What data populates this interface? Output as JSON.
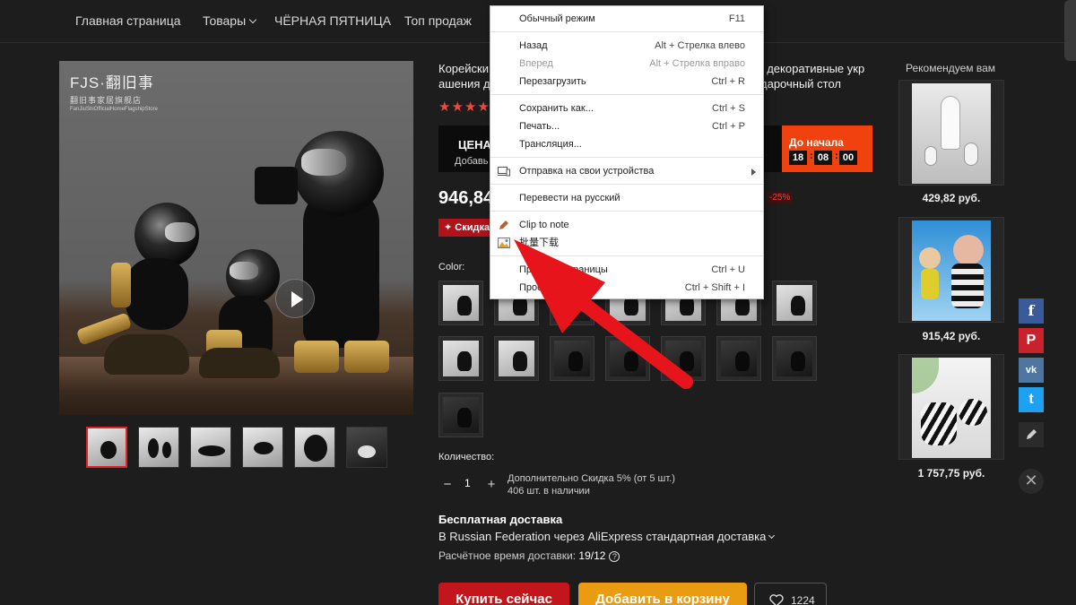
{
  "nav": {
    "items": [
      "Главная страница",
      "Товары",
      "ЧЁРНАЯ ПЯТНИЦА",
      "Топ продаж"
    ]
  },
  "gallery": {
    "brand_main": "FJS·翻旧事",
    "brand_sub": "翻旧事家居旗舰店",
    "brand_tiny": "FanJiuShiOfficialHomeFlagshipStore",
    "play_icon": "play-icon"
  },
  "product": {
    "title_left": "Корейски\nашения д",
    "title_right": ", декоративные укр\nдарочный стол",
    "stars": "★★★★",
    "price_band_label": "ЦЕНА",
    "price_band_sub": "Добавь",
    "countdown_label": "До начала",
    "countdown": [
      "18",
      "08",
      "00"
    ],
    "price": "946,84",
    "discount": "-25%",
    "sale_badge": "✦ Скидка",
    "color_label": "Color:",
    "quantity_label": "Количество:",
    "qty_minus": "−",
    "qty_value": "1",
    "qty_plus": "+",
    "qty_note1": "Дополнительно Скидка 5% (от 5 шт.)",
    "qty_note2": "406 шт. в наличии",
    "ship_title": "Бесплатная доставка",
    "ship_line": "В Russian Federation через AliExpress стандартная доставка",
    "ship_time_label": "Расчётное время доставки:",
    "ship_time_value": "19/12",
    "buy_now": "Купить сейчас",
    "add_to_cart": "Добавить в корзину",
    "wishlist_count": "1224"
  },
  "recommend": {
    "title": "Рекомендуем вам",
    "prices": [
      "429,82 руб.",
      "915,42 руб.",
      "1 757,75 руб."
    ]
  },
  "social": {
    "fb": "f",
    "pinterest": "P",
    "vk": "vk",
    "twitter": "t",
    "close": "✕"
  },
  "context_menu": {
    "items": [
      {
        "label": "Обычный режим",
        "shortcut": "F11"
      },
      {
        "label": "Назад",
        "shortcut": "Alt + Стрелка влево"
      },
      {
        "label": "Вперед",
        "shortcut": "Alt + Стрелка вправо"
      },
      {
        "label": "Перезагрузить",
        "shortcut": "Ctrl + R"
      },
      {
        "label": "Сохранить как...",
        "shortcut": "Ctrl + S"
      },
      {
        "label": "Печать...",
        "shortcut": "Ctrl + P"
      },
      {
        "label": "Трансляция...",
        "shortcut": ""
      },
      {
        "label": "Отправка на свои устройства",
        "shortcut": ""
      },
      {
        "label": "Перевести на русский",
        "shortcut": ""
      },
      {
        "label": "Clip to note",
        "shortcut": ""
      },
      {
        "label": "批量下载",
        "shortcut": ""
      },
      {
        "label": "Про                 кода страницы",
        "shortcut": "Ctrl + U"
      },
      {
        "label": "Прос",
        "shortcut": "Ctrl + Shift + I"
      }
    ]
  },
  "colors": {
    "accent_red": "#c3161c",
    "accent_orange": "#e99b12",
    "countdown_orange": "#f0410e",
    "annotation_arrow": "#e8141c"
  }
}
